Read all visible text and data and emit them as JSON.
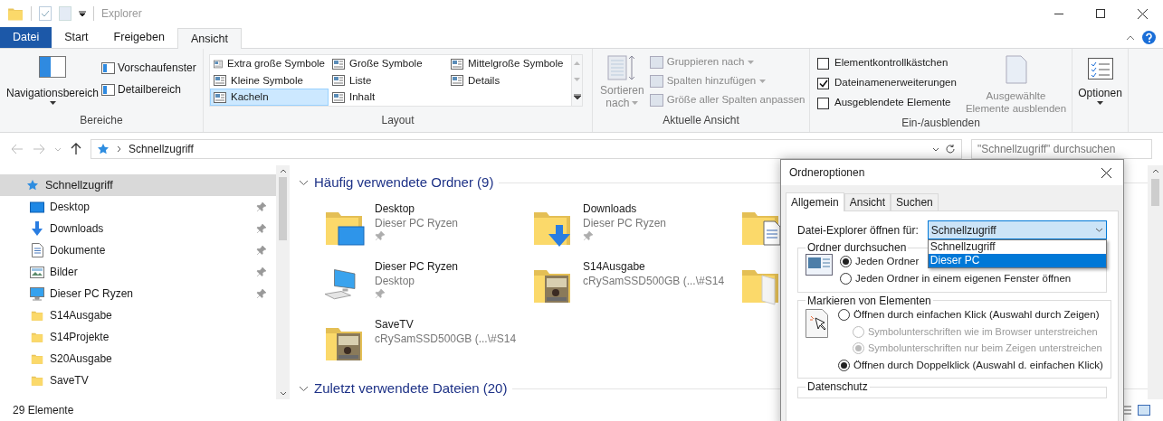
{
  "window": {
    "title": "Explorer"
  },
  "ribbon_tabs": [
    {
      "label": "Datei",
      "kind": "file",
      "selected": false
    },
    {
      "label": "Start",
      "kind": "tab",
      "selected": false
    },
    {
      "label": "Freigeben",
      "kind": "tab",
      "selected": false
    },
    {
      "label": "Ansicht",
      "kind": "tab",
      "selected": true
    }
  ],
  "panes_group": {
    "label": "Bereiche",
    "large": "Navigationsbereich",
    "small": [
      "Vorschaufenster",
      "Detailbereich"
    ]
  },
  "layout_group": {
    "label": "Layout",
    "options": [
      {
        "label": "Extra große Symbole",
        "selected": false
      },
      {
        "label": "Kleine Symbole",
        "selected": false
      },
      {
        "label": "Kacheln",
        "selected": true
      },
      {
        "label": "Große Symbole",
        "selected": false
      },
      {
        "label": "Liste",
        "selected": false
      },
      {
        "label": "Inhalt",
        "selected": false
      },
      {
        "label": "Mittelgroße Symbole",
        "selected": false
      },
      {
        "label": "Details",
        "selected": false
      }
    ]
  },
  "view_group": {
    "label": "Aktuelle Ansicht",
    "sort": [
      "Sortieren",
      "nach"
    ],
    "sort_disabled": true,
    "actions": [
      {
        "label": "Gruppieren nach",
        "dropdown": true,
        "disabled": true
      },
      {
        "label": "Spalten hinzufügen",
        "dropdown": true,
        "disabled": true
      },
      {
        "label": "Größe aller Spalten anpassen",
        "dropdown": false,
        "disabled": true
      }
    ]
  },
  "show_group": {
    "label": "Ein-/ausblenden",
    "checkboxes": [
      {
        "label": "Elementkontrollkästchen",
        "checked": false
      },
      {
        "label": "Dateinamenerweiterungen",
        "checked": true
      },
      {
        "label": "Ausgeblendete Elemente",
        "checked": false
      }
    ],
    "hide_selected": [
      "Ausgewählte",
      "Elemente ausblenden"
    ],
    "hide_disabled": true
  },
  "options_button": "Optionen",
  "address": {
    "path": "Schnellzugriff",
    "search_placeholder": "\"Schnellzugriff\" durchsuchen"
  },
  "nav": [
    {
      "label": "Schnellzugriff",
      "kind": "star",
      "pinned": false,
      "selected": true
    },
    {
      "label": "Desktop",
      "kind": "desktop",
      "pinned": true,
      "selected": false
    },
    {
      "label": "Downloads",
      "kind": "download",
      "pinned": true,
      "selected": false
    },
    {
      "label": "Dokumente",
      "kind": "document",
      "pinned": true,
      "selected": false
    },
    {
      "label": "Bilder",
      "kind": "image",
      "pinned": true,
      "selected": false
    },
    {
      "label": "Dieser PC Ryzen",
      "kind": "pc",
      "pinned": true,
      "selected": false
    },
    {
      "label": "S14Ausgabe",
      "kind": "folder",
      "pinned": false,
      "selected": false
    },
    {
      "label": "S14Projekte",
      "kind": "folder",
      "pinned": false,
      "selected": false
    },
    {
      "label": "S20Ausgabe",
      "kind": "folder",
      "pinned": false,
      "selected": false
    },
    {
      "label": "SaveTV",
      "kind": "folder",
      "pinned": false,
      "selected": false
    }
  ],
  "sections": [
    {
      "title": "Häufig verwendete Ordner (9)",
      "tiles": [
        {
          "name": "Desktop",
          "sub": "Dieser PC Ryzen",
          "pinned": true,
          "kind": "folder-desktop"
        },
        {
          "name": "Downloads",
          "sub": "Dieser PC Ryzen",
          "pinned": true,
          "kind": "folder-download"
        },
        {
          "kind": "folder-document"
        },
        {
          "name": "Dieser PC Ryzen",
          "sub": "Desktop",
          "pinned": true,
          "kind": "pc"
        },
        {
          "name": "S14Ausgabe",
          "sub": "cRySamSSD500GB (...\\#S14",
          "pinned": false,
          "kind": "folder-picture"
        },
        {
          "kind": "folder-blank"
        },
        {
          "name": "SaveTV",
          "sub": "cRySamSSD500GB (...\\#S14",
          "pinned": false,
          "kind": "folder-picture"
        }
      ]
    },
    {
      "title": "Zuletzt verwendete Dateien (20)"
    }
  ],
  "status_bar": "29 Elemente",
  "dialog": {
    "title": "Ordneroptionen",
    "tabs": [
      {
        "label": "Allgemein",
        "selected": true
      },
      {
        "label": "Ansicht",
        "selected": false
      },
      {
        "label": "Suchen",
        "selected": false
      }
    ],
    "open_label": "Datei-Explorer öffnen für:",
    "open_value": "Schnellzugriff",
    "open_options": [
      {
        "label": "Schnellzugriff",
        "selected": false
      },
      {
        "label": "Dieser PC",
        "selected": true
      }
    ],
    "groups": [
      {
        "title": "Ordner durchsuchen",
        "kind": "window",
        "options": [
          {
            "label": "Jeden Ordner",
            "checked": true,
            "disabled": false,
            "indent": false
          },
          {
            "label": "Jeden Ordner in einem eigenen Fenster öffnen",
            "checked": false,
            "disabled": false,
            "indent": false
          }
        ]
      },
      {
        "title": "Markieren von Elementen",
        "kind": "cursor",
        "options": [
          {
            "label": "Öffnen durch einfachen Klick (Auswahl durch Zeigen)",
            "checked": false,
            "disabled": false,
            "indent": false
          },
          {
            "label": "Symbolunterschriften wie im Browser unterstreichen",
            "checked": false,
            "disabled": true,
            "indent": true
          },
          {
            "label": "Symbolunterschriften nur beim Zeigen unterstreichen",
            "checked": true,
            "disabled": true,
            "indent": true
          },
          {
            "label": "Öffnen durch Doppelklick (Auswahl d. einfachen Klick)",
            "checked": true,
            "disabled": false,
            "indent": false
          }
        ]
      },
      {
        "title": "Datenschutz"
      }
    ]
  }
}
